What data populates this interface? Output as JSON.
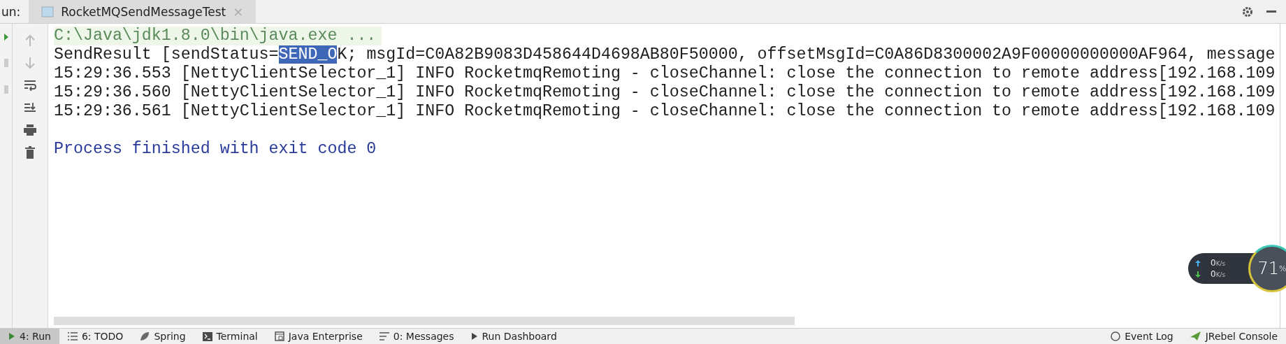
{
  "run_bar": {
    "label": "un:",
    "tabs": [
      {
        "label": "RocketMQSendMessageTest",
        "selected": true,
        "close": "×"
      }
    ]
  },
  "console": {
    "lines": [
      {
        "kind": "command",
        "parts": [
          {
            "text": "C:\\Java\\jdk1.8.0\\bin\\java.exe ...",
            "selected": false
          }
        ]
      },
      {
        "kind": "output",
        "parts": [
          {
            "text": "SendResult [sendStatus=",
            "selected": false
          },
          {
            "text": "SEND_O",
            "selected": true
          },
          {
            "text": "K; msgId=C0A82B9083D458644D4698AB80F50000, offsetMsgId=C0A86D8300002A9F00000000000AF964, message",
            "selected": false
          }
        ]
      },
      {
        "kind": "output",
        "parts": [
          {
            "text": "15:29:36.553 [NettyClientSelector_1] INFO RocketmqRemoting - closeChannel: close the connection to remote address[192.168.109",
            "selected": false
          }
        ]
      },
      {
        "kind": "output",
        "parts": [
          {
            "text": "15:29:36.560 [NettyClientSelector_1] INFO RocketmqRemoting - closeChannel: close the connection to remote address[192.168.109",
            "selected": false
          }
        ]
      },
      {
        "kind": "output",
        "parts": [
          {
            "text": "15:29:36.561 [NettyClientSelector_1] INFO RocketmqRemoting - closeChannel: close the connection to remote address[192.168.109",
            "selected": false
          }
        ]
      },
      {
        "kind": "blank"
      },
      {
        "kind": "exit",
        "parts": [
          {
            "text": "Process finished with exit code 0",
            "selected": false
          }
        ]
      }
    ]
  },
  "network_widget": {
    "upload": "0",
    "upload_unit": "K/s",
    "download": "0",
    "download_unit": "K/s",
    "percent": "71",
    "percent_sign": "%"
  },
  "tool_bar": {
    "left": [
      {
        "label": "4: Run",
        "selected": true
      },
      {
        "label": "6: TODO",
        "selected": false
      },
      {
        "label": "Spring",
        "selected": false
      },
      {
        "label": "Terminal",
        "selected": false
      },
      {
        "label": "Java Enterprise",
        "selected": false
      },
      {
        "label": "0: Messages",
        "selected": false
      },
      {
        "label": "Run Dashboard",
        "selected": false
      }
    ],
    "right": [
      {
        "label": "Event Log",
        "selected": false
      },
      {
        "label": "JRebel Console",
        "selected": false
      }
    ]
  }
}
